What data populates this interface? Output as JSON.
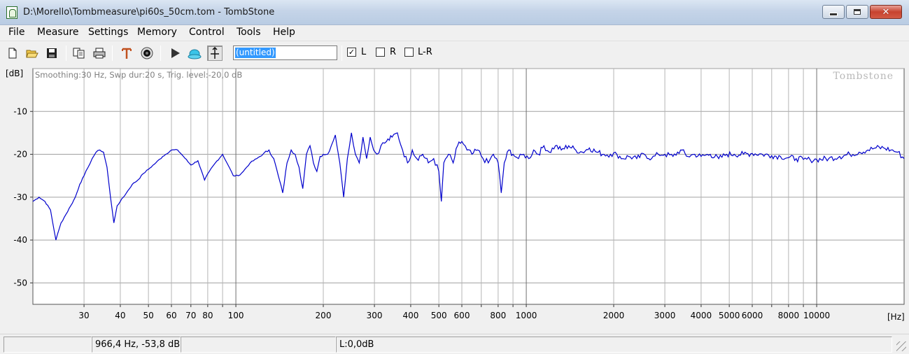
{
  "window": {
    "title": "D:\\Morello\\Tombmeasure\\pi60s_50cm.tom - TombStone",
    "min_label": "minimize",
    "max_label": "maximize",
    "close_glyph": "✕"
  },
  "menu": {
    "items": [
      "File",
      "Measure",
      "Settings",
      "Memory",
      "Control",
      "Tools",
      "Help"
    ]
  },
  "toolbar": {
    "icons": [
      "new-file-icon",
      "open-folder-icon",
      "save-disk-icon",
      "copy-icon",
      "print-icon",
      "marker-icon",
      "record-icon",
      "play-icon",
      "speaker-icon",
      "axis-icon"
    ],
    "name_value": "(untitled)",
    "channels": [
      {
        "label": "L",
        "checked": true
      },
      {
        "label": "R",
        "checked": false
      },
      {
        "label": "L-R",
        "checked": false
      }
    ]
  },
  "graph": {
    "unit_y": "[dB]",
    "unit_x": "[Hz]",
    "info": "Smoothing:30 Hz, Swp dur:20 s, Trig. level:-20,0 dB",
    "watermark": "Tombstone",
    "line_color": "#0000cc"
  },
  "chart_data": {
    "type": "line",
    "title": "",
    "xlabel": "[Hz]",
    "ylabel": "[dB]",
    "x_scale": "log",
    "xlim": [
      20,
      20000
    ],
    "ylim": [
      -55,
      0
    ],
    "grid": true,
    "ytick_labels": [
      "-10",
      "-20",
      "-30",
      "-40",
      "-50"
    ],
    "ytick_values": [
      -10,
      -20,
      -30,
      -40,
      -50
    ],
    "xtick_labels": [
      "30",
      "40",
      "50",
      "60",
      "70",
      "80",
      "100",
      "200",
      "300",
      "400",
      "500",
      "600",
      "800",
      "1000",
      "2000",
      "3000",
      "4000",
      "5000",
      "6000",
      "8000",
      "10000"
    ],
    "xtick_values": [
      30,
      40,
      50,
      60,
      70,
      80,
      100,
      200,
      300,
      400,
      500,
      600,
      800,
      1000,
      2000,
      3000,
      4000,
      5000,
      6000,
      8000,
      10000
    ],
    "series": [
      {
        "color": "#0000cc",
        "points": [
          [
            20,
            -31
          ],
          [
            21,
            -30
          ],
          [
            22,
            -31
          ],
          [
            23,
            -33
          ],
          [
            24,
            -40
          ],
          [
            25,
            -36
          ],
          [
            26,
            -34
          ],
          [
            27,
            -32
          ],
          [
            28,
            -30
          ],
          [
            29,
            -27
          ],
          [
            30,
            -25
          ],
          [
            31,
            -23
          ],
          [
            32,
            -21
          ],
          [
            33,
            -19.5
          ],
          [
            34,
            -19
          ],
          [
            35,
            -19.5
          ],
          [
            36,
            -23
          ],
          [
            37,
            -30
          ],
          [
            38,
            -36
          ],
          [
            39,
            -32
          ],
          [
            40,
            -31
          ],
          [
            42,
            -29
          ],
          [
            44,
            -27
          ],
          [
            46,
            -26
          ],
          [
            48,
            -24.5
          ],
          [
            50,
            -23.5
          ],
          [
            53,
            -22
          ],
          [
            56,
            -20.5
          ],
          [
            60,
            -19
          ],
          [
            63,
            -19
          ],
          [
            66,
            -20.5
          ],
          [
            70,
            -22.5
          ],
          [
            74,
            -21.5
          ],
          [
            78,
            -26
          ],
          [
            81,
            -24
          ],
          [
            85,
            -22
          ],
          [
            90,
            -20
          ],
          [
            94,
            -22.5
          ],
          [
            98,
            -25
          ],
          [
            102,
            -25
          ],
          [
            106,
            -24
          ],
          [
            112,
            -22
          ],
          [
            118,
            -21
          ],
          [
            124,
            -20
          ],
          [
            130,
            -19
          ],
          [
            135,
            -21
          ],
          [
            140,
            -25
          ],
          [
            145,
            -29
          ],
          [
            150,
            -22
          ],
          [
            155,
            -19
          ],
          [
            160,
            -20
          ],
          [
            165,
            -23
          ],
          [
            170,
            -28
          ],
          [
            175,
            -20
          ],
          [
            180,
            -18
          ],
          [
            185,
            -22
          ],
          [
            190,
            -24
          ],
          [
            195,
            -20.5
          ],
          [
            200,
            -20
          ],
          [
            207,
            -20
          ],
          [
            213,
            -18
          ],
          [
            220,
            -15.5
          ],
          [
            228,
            -22
          ],
          [
            235,
            -30
          ],
          [
            242,
            -21
          ],
          [
            250,
            -15
          ],
          [
            258,
            -20
          ],
          [
            266,
            -22
          ],
          [
            274,
            -16
          ],
          [
            282,
            -21
          ],
          [
            290,
            -16
          ],
          [
            298,
            -19
          ],
          [
            306,
            -20
          ],
          [
            316,
            -18
          ],
          [
            330,
            -17
          ],
          [
            345,
            -16
          ],
          [
            360,
            -15
          ],
          [
            375,
            -19
          ],
          [
            390,
            -22
          ],
          [
            405,
            -19
          ],
          [
            420,
            -21
          ],
          [
            440,
            -20
          ],
          [
            460,
            -22
          ],
          [
            480,
            -21
          ],
          [
            500,
            -24
          ],
          [
            510,
            -31
          ],
          [
            520,
            -22
          ],
          [
            540,
            -20
          ],
          [
            560,
            -22
          ],
          [
            580,
            -18
          ],
          [
            600,
            -17
          ],
          [
            625,
            -19
          ],
          [
            650,
            -20
          ],
          [
            680,
            -19
          ],
          [
            710,
            -21
          ],
          [
            740,
            -22
          ],
          [
            770,
            -20
          ],
          [
            800,
            -22
          ],
          [
            820,
            -29
          ],
          [
            840,
            -22
          ],
          [
            870,
            -19
          ],
          [
            900,
            -20
          ],
          [
            940,
            -21
          ],
          [
            980,
            -20
          ],
          [
            1020,
            -21
          ],
          [
            1060,
            -19
          ],
          [
            1100,
            -20
          ],
          [
            1150,
            -18
          ],
          [
            1200,
            -19.5
          ],
          [
            1260,
            -18
          ],
          [
            1320,
            -19
          ],
          [
            1400,
            -18
          ],
          [
            1480,
            -19
          ],
          [
            1560,
            -19.5
          ],
          [
            1650,
            -18.5
          ],
          [
            1750,
            -19.5
          ],
          [
            1850,
            -20
          ],
          [
            1950,
            -20
          ],
          [
            2050,
            -20
          ],
          [
            2150,
            -21
          ],
          [
            2250,
            -20.5
          ],
          [
            2400,
            -21
          ],
          [
            2550,
            -20
          ],
          [
            2700,
            -21
          ],
          [
            2850,
            -20
          ],
          [
            3000,
            -20
          ],
          [
            3200,
            -20.5
          ],
          [
            3400,
            -19
          ],
          [
            3600,
            -20.5
          ],
          [
            3800,
            -20
          ],
          [
            4000,
            -20.5
          ],
          [
            4300,
            -20
          ],
          [
            4600,
            -21
          ],
          [
            4900,
            -20
          ],
          [
            5200,
            -20
          ],
          [
            5600,
            -20
          ],
          [
            6000,
            -19.8
          ],
          [
            6500,
            -20
          ],
          [
            7000,
            -20.3
          ],
          [
            7500,
            -20.5
          ],
          [
            8000,
            -20.8
          ],
          [
            8500,
            -21
          ],
          [
            9000,
            -21.2
          ],
          [
            9500,
            -21.3
          ],
          [
            10000,
            -21.2
          ],
          [
            11000,
            -21
          ],
          [
            12000,
            -20.5
          ],
          [
            13000,
            -20
          ],
          [
            14000,
            -19.5
          ],
          [
            15000,
            -19
          ],
          [
            16000,
            -18.5
          ],
          [
            17000,
            -18.5
          ],
          [
            18000,
            -19
          ],
          [
            19000,
            -19.5
          ],
          [
            20000,
            -21
          ]
        ]
      }
    ]
  },
  "status": {
    "cursor_readout": "966,4 Hz, -53,8 dB",
    "level_readout": "L:0,0dB"
  }
}
